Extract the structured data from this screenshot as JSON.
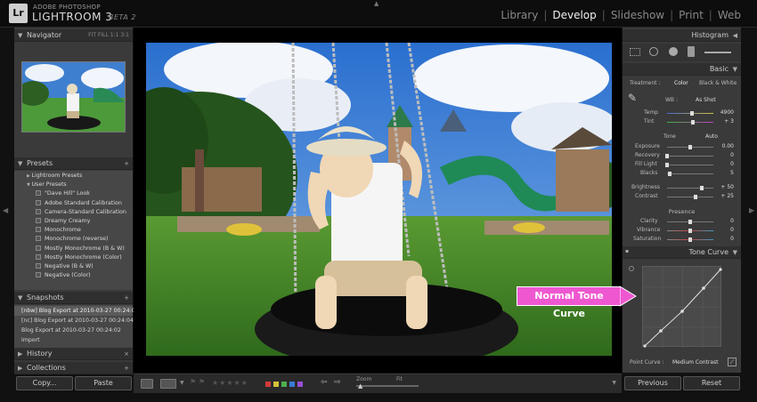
{
  "app": {
    "brand_top": "ADOBE PHOTOSHOP",
    "brand_main": "LIGHTROOM 3",
    "brand_beta": "BETA 2",
    "logo": "Lr"
  },
  "modules": [
    "Library",
    "Develop",
    "Slideshow",
    "Print",
    "Web"
  ],
  "active_module": "Develop",
  "left_panel": {
    "navigator": {
      "title": "Navigator",
      "options": "FIT  FILL  1:1  3:1"
    },
    "presets": {
      "title": "Presets",
      "add": "+",
      "groups": [
        {
          "label": "Lightroom Presets",
          "expanded": false
        },
        {
          "label": "User Presets",
          "expanded": true
        }
      ],
      "items": [
        "\"Dave Hill\" Look",
        "Adobe Standard Calibration",
        "Camera-Standard Calibration",
        "Dreamy Creamy",
        "Monochrome",
        "Monochrome (reverse)",
        "Mostly Monochrome (B & W)",
        "Mostly Monochrome (Color)",
        "Negative (B & W)",
        "Negative (Color)"
      ]
    },
    "snapshots": {
      "title": "Snapshots",
      "add": "+",
      "items": [
        "[nbw] Blog Export at 2010-03-27 00:24:06",
        "[nc] Blog Export at 2010-03-27 00:24:04",
        "Blog Export at 2010-03-27 00:24:02",
        "Import"
      ],
      "selected_index": 0
    },
    "history": {
      "title": "History",
      "close": "×"
    },
    "collections": {
      "title": "Collections",
      "add": "+"
    },
    "buttons": {
      "copy": "Copy...",
      "paste": "Paste"
    }
  },
  "toolbar": {
    "stars": "★★★★★",
    "zoom_label": "Zoom",
    "fit_label": "Fit",
    "color_labels": [
      "#d33a3a",
      "#d6c23a",
      "#4fb04f",
      "#3a7ad6",
      "#9a4fd6"
    ]
  },
  "right_panel": {
    "histogram": {
      "title": "Histogram"
    },
    "basic": {
      "title": "Basic",
      "treatment_label": "Treatment :",
      "treatment_options": [
        "Color",
        "Black & White"
      ],
      "wb_label": "WB :",
      "wb_value": "As Shot",
      "temp": {
        "label": "Temp",
        "value": "4900",
        "pos": 0.5
      },
      "tint": {
        "label": "Tint",
        "value": "+ 3",
        "pos": 0.52
      },
      "tone_label": "Tone",
      "tone_auto": "Auto",
      "exposure": {
        "label": "Exposure",
        "value": "0.00",
        "pos": 0.5
      },
      "recovery": {
        "label": "Recovery",
        "value": "0",
        "pos": 0.0
      },
      "fill_light": {
        "label": "Fill Light",
        "value": "0",
        "pos": 0.0
      },
      "blacks": {
        "label": "Blacks",
        "value": "5",
        "pos": 0.05
      },
      "brightness": {
        "label": "Brightness",
        "value": "+ 50",
        "pos": 0.75
      },
      "contrast": {
        "label": "Contrast",
        "value": "+ 25",
        "pos": 0.62
      },
      "presence_label": "Presence",
      "clarity": {
        "label": "Clarity",
        "value": "0",
        "pos": 0.5
      },
      "vibrance": {
        "label": "Vibrance",
        "value": "0",
        "pos": 0.5
      },
      "saturation": {
        "label": "Saturation",
        "value": "0",
        "pos": 0.5
      }
    },
    "tone_curve": {
      "title": "Tone Curve",
      "point_curve_label": "Point Curve :",
      "point_curve_value": "Medium Contrast"
    },
    "buttons": {
      "previous": "Previous",
      "reset": "Reset"
    }
  },
  "annotation": {
    "text": "Normal Tone Curve",
    "color": "#ee57d0"
  }
}
